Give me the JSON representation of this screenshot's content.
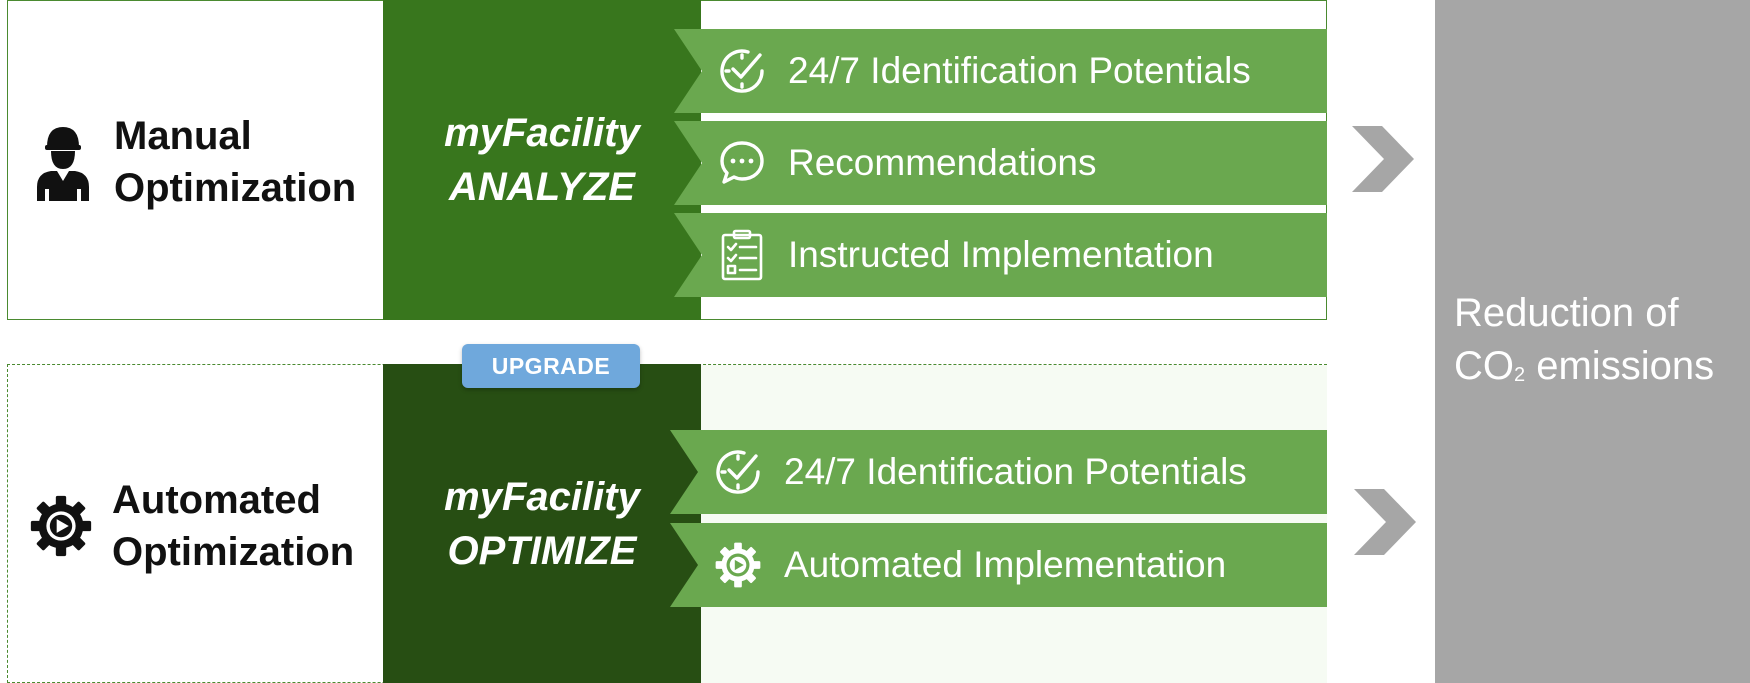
{
  "rows": [
    {
      "label_line1": "Manual",
      "label_line2": "Optimization",
      "icon": "worker-icon",
      "product_line1": "myFacility",
      "product_line2": "ANALYZE",
      "features": [
        {
          "icon": "clock-check-icon",
          "label": "24/7 Identification Potentials"
        },
        {
          "icon": "chat-bubble-icon",
          "label": "Recommendations"
        },
        {
          "icon": "clipboard-checklist-icon",
          "label": "Instructed Implementation"
        }
      ]
    },
    {
      "label_line1": "Automated",
      "label_line2": "Optimization",
      "icon": "gear-play-icon",
      "product_line1": "myFacility",
      "product_line2": "OPTIMIZE",
      "badge": "UPGRADE",
      "features": [
        {
          "icon": "clock-check-icon",
          "label": "24/7 Identification Potentials"
        },
        {
          "icon": "gear-play-icon",
          "label": "Automated Implementation"
        }
      ]
    }
  ],
  "result": {
    "line1": "Reduction of",
    "line2_prefix": "CO",
    "line2_sub": "2",
    "line2_suffix": " emissions"
  },
  "colors": {
    "banner_green": "#6aa84f",
    "analyze_green": "#38761d",
    "optimize_green": "#274e13",
    "badge_blue": "#6fa8dc",
    "result_gray": "#a6a6a6",
    "arrow_gray": "#a6a6a6"
  }
}
